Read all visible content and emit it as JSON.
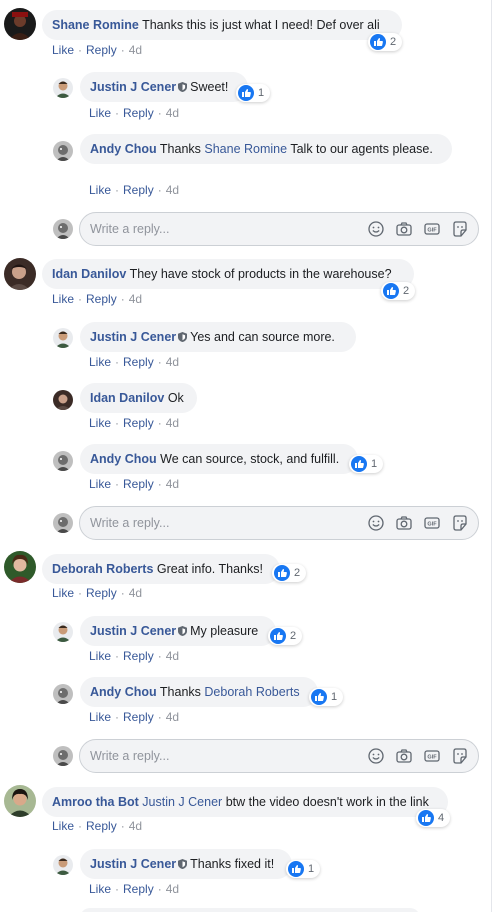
{
  "labels": {
    "like": "Like",
    "reply": "Reply",
    "time": "4d",
    "reply_placeholder": "Write a reply..."
  },
  "colors": {
    "author": "#385898",
    "like_blue": "#1877f2",
    "bubble_bg": "#f2f3f5"
  },
  "icons": {
    "verified": "shield-icon",
    "like": "thumbs-up-icon",
    "emoji": "smiley-icon",
    "camera": "camera-icon",
    "gif": "gif-icon",
    "sticker": "sticker-icon"
  },
  "threads": [
    {
      "comment": {
        "author": "Shane Romine",
        "text": "Thanks this is just what I need! Def over ali",
        "likes": "2"
      },
      "replies": [
        {
          "author": "Justin J Cener",
          "text": "Sweet!",
          "likes": "1"
        },
        {
          "author": "Andy Chou",
          "text_pre": "Thanks ",
          "mention": "Shane Romine",
          "text_post": " Talk to our agents please."
        }
      ]
    },
    {
      "comment": {
        "author": "Idan Danilov",
        "text": "They have stock of products in the warehouse?",
        "likes": "2"
      },
      "replies": [
        {
          "author": "Justin J Cener",
          "text": "Yes and can source more."
        },
        {
          "author": "Idan Danilov",
          "text": "Ok"
        },
        {
          "author": "Andy Chou",
          "text": "We can source, stock, and fulfill.",
          "likes": "1"
        }
      ]
    },
    {
      "comment": {
        "author": "Deborah Roberts",
        "text": "Great info. Thanks!",
        "likes": "2"
      },
      "replies": [
        {
          "author": "Justin J Cener",
          "text": "My pleasure",
          "likes": "2"
        },
        {
          "author": "Andy Chou",
          "text_pre": "Thanks ",
          "mention": "Deborah Roberts",
          "likes": "1"
        }
      ]
    },
    {
      "comment": {
        "author": "Amroo tha Bot",
        "mention": "Justin J Cener",
        "text": "btw the video doesn't work in the link",
        "likes": "4"
      },
      "replies": [
        {
          "author": "Justin J Cener",
          "text": "Thanks fixed it!",
          "likes": "1"
        }
      ]
    }
  ]
}
